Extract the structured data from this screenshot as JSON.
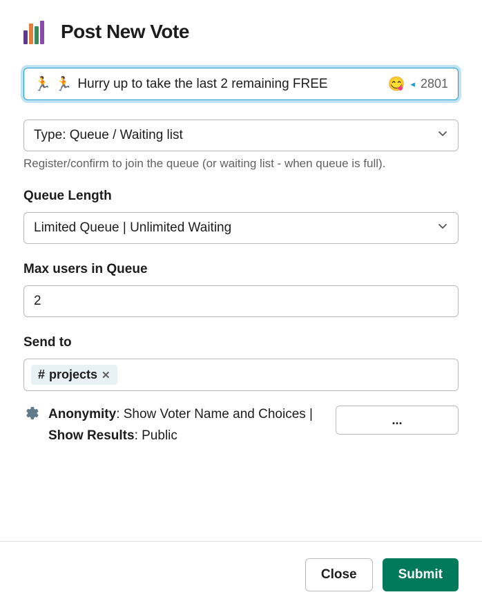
{
  "header": {
    "title": "Post New Vote"
  },
  "vote_title": {
    "emoji_left": "🏃 🏃",
    "text": "Hurry up to take the last 2 remaining FREE",
    "emoji_right": "😋",
    "count": "2801"
  },
  "type_select": {
    "value": "Type: Queue / Waiting list",
    "helper": "Register/confirm to join the queue (or waiting list - when queue is full)."
  },
  "queue_length": {
    "label": "Queue Length",
    "value": "Limited Queue | Unlimited Waiting"
  },
  "max_users": {
    "label": "Max users in Queue",
    "value": "2"
  },
  "send_to": {
    "label": "Send to",
    "chip": {
      "hash": "#",
      "name": "projects"
    }
  },
  "settings": {
    "anonymity_label": "Anonymity",
    "anonymity_value": ": Show Voter Name and Choices | ",
    "results_label": "Show Results",
    "results_value": ": Public",
    "more": "..."
  },
  "footer": {
    "close": "Close",
    "submit": "Submit"
  }
}
